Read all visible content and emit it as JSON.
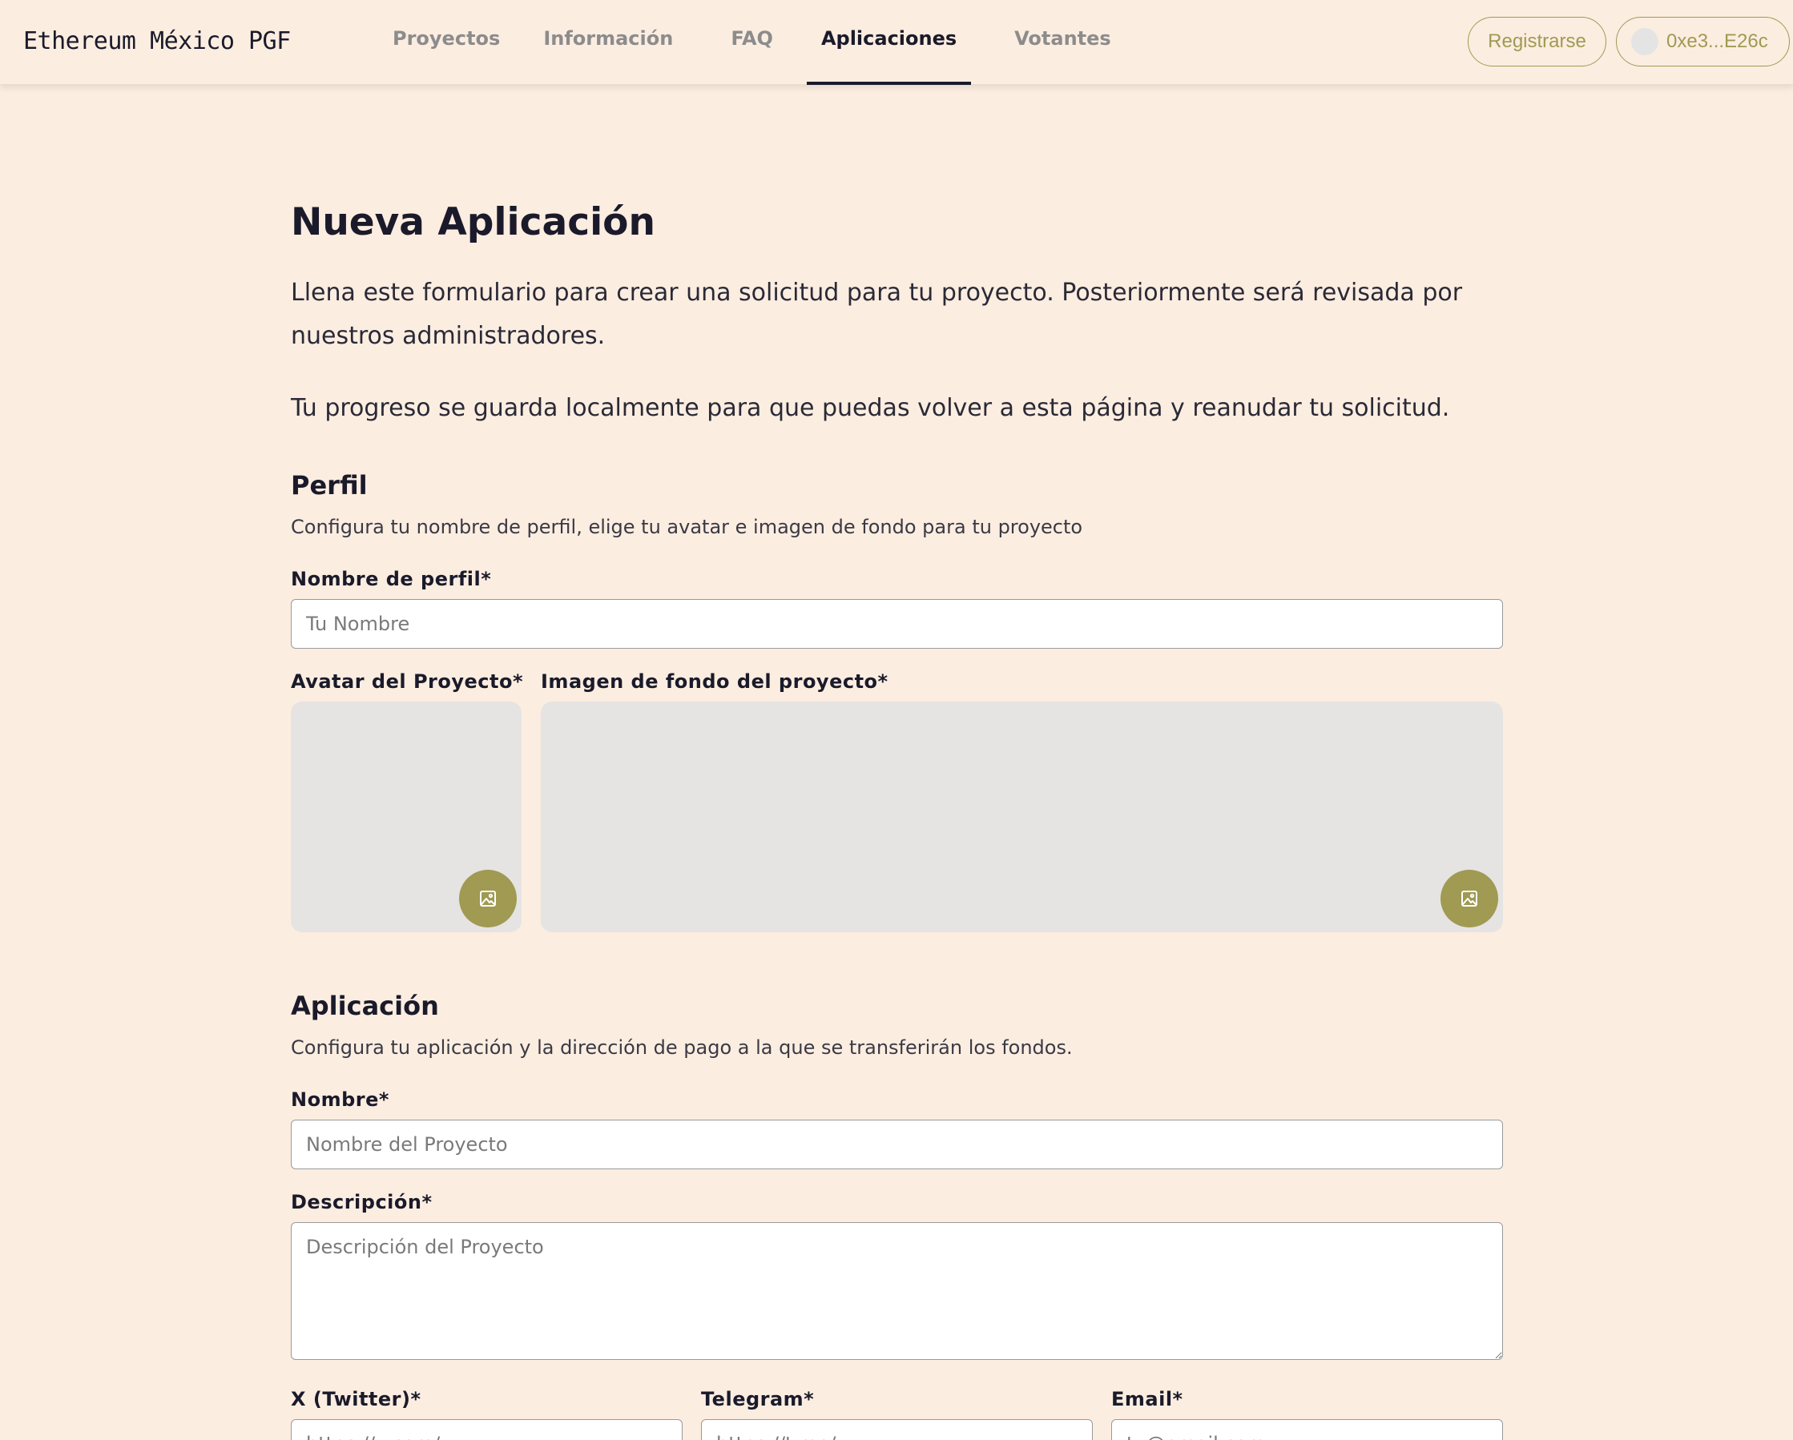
{
  "header": {
    "brand": "Ethereum México PGF",
    "nav": [
      {
        "label": "Proyectos"
      },
      {
        "label": "Información"
      },
      {
        "label": "FAQ"
      },
      {
        "label": "Aplicaciones"
      },
      {
        "label": "Votantes"
      }
    ],
    "register_label": "Registrarse",
    "wallet_label": "0xe3...E26c"
  },
  "page": {
    "title": "Nueva Aplicación",
    "intro_1": "Llena este formulario para crear una solicitud para tu proyecto. Posteriormente será revisada por nuestros administradores.",
    "intro_2": "Tu progreso se guarda localmente para que puedas volver a esta página y reanudar tu solicitud."
  },
  "profile": {
    "title": "Perfil",
    "subtitle": "Configura tu nombre de perfil, elige tu avatar e imagen de fondo para tu proyecto",
    "name_label": "Nombre de perfil*",
    "name_placeholder": "Tu Nombre",
    "avatar_label": "Avatar del Proyecto*",
    "background_label": "Imagen de fondo del proyecto*"
  },
  "application": {
    "title": "Aplicación",
    "subtitle": "Configura tu aplicación y la dirección de pago a la que se transferirán los fondos.",
    "name_label": "Nombre*",
    "name_placeholder": "Nombre del Proyecto",
    "description_label": "Descripción*",
    "description_placeholder": "Descripción del Proyecto",
    "twitter_label": "X (Twitter)*",
    "twitter_placeholder": "https://x.com/",
    "telegram_label": "Telegram*",
    "telegram_placeholder": "https://t.me/",
    "email_label": "Email*",
    "email_placeholder": "tu@email.com"
  },
  "colors": {
    "background": "#fcede1",
    "accent": "#a09a52",
    "text": "#1a1a2a"
  },
  "icons": [
    "image-upload-icon"
  ]
}
